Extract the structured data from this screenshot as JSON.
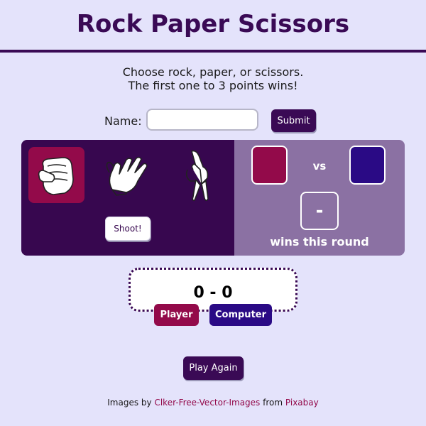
{
  "page": {
    "title": "Rock Paper Scissors",
    "intro_line1": "Choose rock, paper, or scissors.",
    "intro_line2": "The first one to 3 points wins!"
  },
  "name_form": {
    "label": "Name:",
    "value": "",
    "placeholder": "",
    "submit_label": "Submit"
  },
  "choices": [
    {
      "name": "rock",
      "icon": "rock-fist-icon",
      "selected": true
    },
    {
      "name": "paper",
      "icon": "paper-hand-icon",
      "selected": false
    },
    {
      "name": "scissors",
      "icon": "scissors-hand-icon",
      "selected": false
    }
  ],
  "shoot_label": "Shoot!",
  "result": {
    "vs_label": "vs",
    "winner_symbol": "-",
    "round_text": "wins this round"
  },
  "score": {
    "text": "0 - 0",
    "player_label": "Player",
    "computer_label": "Computer"
  },
  "play_again_label": "Play Again",
  "footer": {
    "prefix": "Images by",
    "author_link": "Clker-Free-Vector-Images",
    "middle": "from",
    "source_link": "Pixabay"
  },
  "colors": {
    "background": "#e4e3fb",
    "primary": "#3a0a55",
    "player": "#930a4a",
    "computer": "#2a0a85",
    "result_panel": "#8b71a3"
  }
}
